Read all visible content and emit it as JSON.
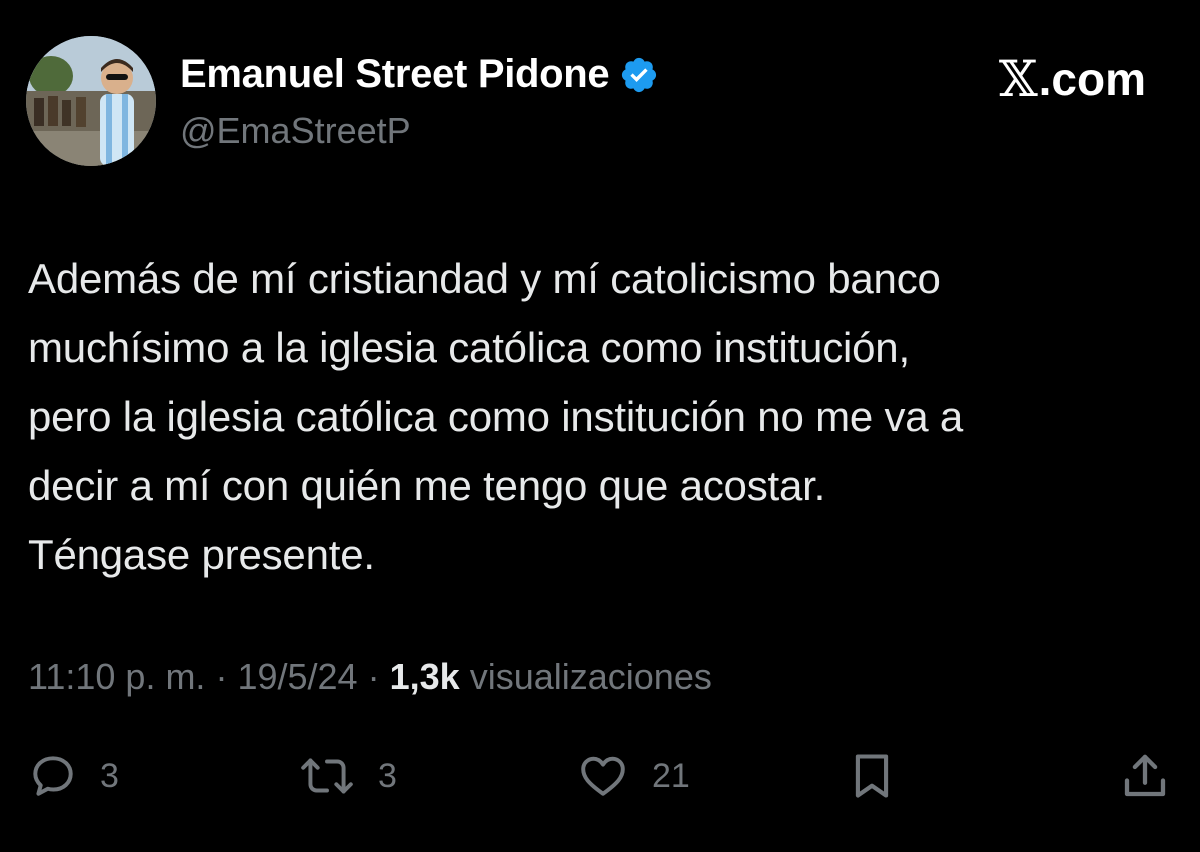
{
  "author": {
    "display_name": "Emanuel Street Pidone",
    "handle": "@EmaStreetP",
    "verified": true,
    "avatar_icon": "avatar-photo"
  },
  "brand": {
    "x_glyph": "𝕏",
    "suffix": ".com"
  },
  "tweet": {
    "text": "Además de mí cristiandad y mí catolicismo banco\nmuchísimo a la iglesia católica como institución,\npero la iglesia católica como institución no me va a\ndecir a mí con quién me tengo que acostar.\nTéngase presente."
  },
  "meta": {
    "time": "11:10 p. m.",
    "separator": "·",
    "date": "19/5/24",
    "views_count": "1,3k",
    "views_label": "visualizaciones"
  },
  "actions": {
    "replies": "3",
    "reposts": "3",
    "likes": "21"
  },
  "colors": {
    "background": "#000000",
    "text_primary": "#e7e9ea",
    "text_secondary": "#71767b",
    "verified": "#1d9bf0"
  }
}
